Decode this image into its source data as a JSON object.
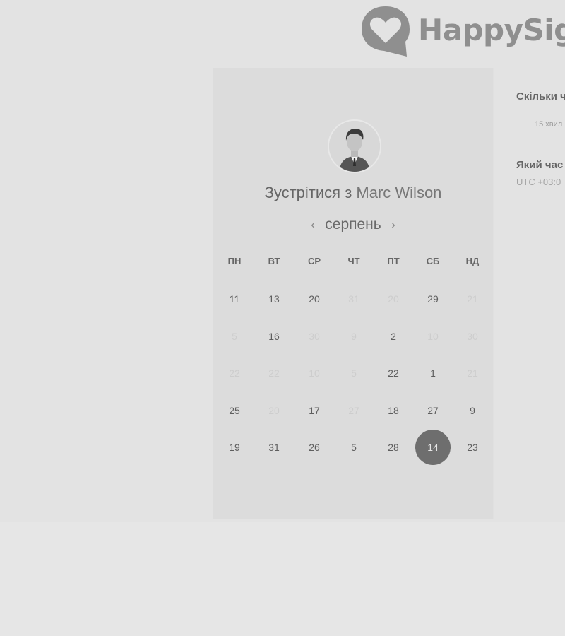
{
  "brand": {
    "name": "HappySig",
    "logo_icon": "heart-speech-bubble-icon",
    "logo_color": "#8f8f8f"
  },
  "scheduler": {
    "avatar_icon": "person-avatar-icon",
    "title_prefix": "Зустрітися з",
    "host_name": "Marc Wilson",
    "month": "серпень",
    "prev_icon": "chevron-left-icon",
    "next_icon": "chevron-right-icon",
    "weekdays": [
      "ПН",
      "ВТ",
      "СР",
      "ЧТ",
      "ПТ",
      "СБ",
      "НД"
    ],
    "weeks": [
      [
        {
          "d": "11",
          "s": "available"
        },
        {
          "d": "13",
          "s": "available"
        },
        {
          "d": "20",
          "s": "available"
        },
        {
          "d": "31",
          "s": "unavailable"
        },
        {
          "d": "20",
          "s": "unavailable"
        },
        {
          "d": "29",
          "s": "available"
        },
        {
          "d": "21",
          "s": "unavailable"
        }
      ],
      [
        {
          "d": "5",
          "s": "unavailable"
        },
        {
          "d": "16",
          "s": "available"
        },
        {
          "d": "30",
          "s": "unavailable"
        },
        {
          "d": "9",
          "s": "unavailable"
        },
        {
          "d": "2",
          "s": "available"
        },
        {
          "d": "10",
          "s": "unavailable"
        },
        {
          "d": "30",
          "s": "unavailable"
        }
      ],
      [
        {
          "d": "22",
          "s": "unavailable"
        },
        {
          "d": "22",
          "s": "unavailable"
        },
        {
          "d": "10",
          "s": "unavailable"
        },
        {
          "d": "5",
          "s": "unavailable"
        },
        {
          "d": "22",
          "s": "available"
        },
        {
          "d": "1",
          "s": "available"
        },
        {
          "d": "21",
          "s": "unavailable"
        }
      ],
      [
        {
          "d": "25",
          "s": "available"
        },
        {
          "d": "20",
          "s": "unavailable"
        },
        {
          "d": "17",
          "s": "available"
        },
        {
          "d": "27",
          "s": "unavailable"
        },
        {
          "d": "18",
          "s": "available"
        },
        {
          "d": "27",
          "s": "available"
        },
        {
          "d": "9",
          "s": "available"
        }
      ],
      [
        {
          "d": "19",
          "s": "available"
        },
        {
          "d": "31",
          "s": "available"
        },
        {
          "d": "26",
          "s": "available"
        },
        {
          "d": "5",
          "s": "available"
        },
        {
          "d": "28",
          "s": "available"
        },
        {
          "d": "14",
          "s": "selected"
        },
        {
          "d": "23",
          "s": "available"
        }
      ]
    ],
    "selected_color": "#6e6e6e"
  },
  "details": {
    "duration_question": "Скільки ч",
    "duration_value": "15 хвил",
    "time_question": "Який час",
    "timezone": "UTC +03:0"
  }
}
